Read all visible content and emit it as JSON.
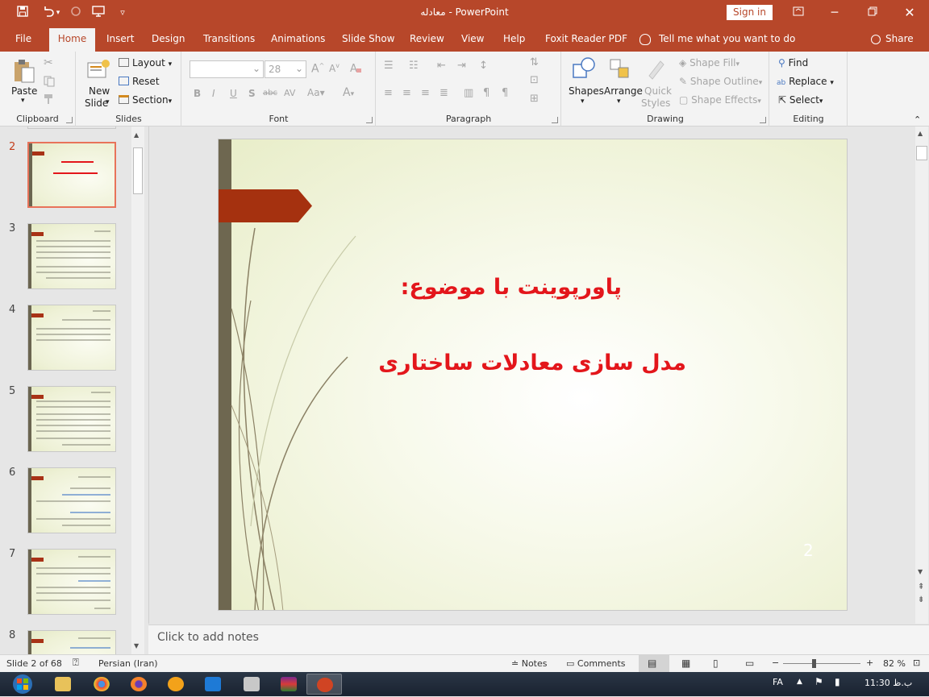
{
  "titlebar": {
    "title": "معادله  -  PowerPoint",
    "sign_in": "Sign in"
  },
  "tabs": [
    "File",
    "Home",
    "Insert",
    "Design",
    "Transitions",
    "Animations",
    "Slide Show",
    "Review",
    "View",
    "Help",
    "Foxit Reader PDF"
  ],
  "tell_me": "Tell me what you want to do",
  "share": "Share",
  "ribbon": {
    "clipboard": {
      "label": "Clipboard",
      "paste": "Paste"
    },
    "slides": {
      "label": "Slides",
      "new_slide_1": "New",
      "new_slide_2": "Slide",
      "layout": "Layout",
      "reset": "Reset",
      "section": "Section"
    },
    "font": {
      "label": "Font",
      "font_size": "28"
    },
    "paragraph": {
      "label": "Paragraph"
    },
    "drawing": {
      "label": "Drawing",
      "shapes": "Shapes",
      "arrange": "Arrange",
      "quick_1": "Quick",
      "quick_2": "Styles",
      "shape_fill": "Shape Fill",
      "shape_outline": "Shape Outline",
      "shape_effects": "Shape Effects"
    },
    "editing": {
      "label": "Editing",
      "find": "Find",
      "replace": "Replace",
      "select": "Select"
    }
  },
  "thumbnails": {
    "n2": "2",
    "n3": "3",
    "n4": "4",
    "n5": "5",
    "n6": "6",
    "n7": "7",
    "n8": "8"
  },
  "slide": {
    "title": "پاورپوینت با موضوع:",
    "subtitle": "مدل سازی معادلات ساختاری",
    "number": "2"
  },
  "notes_placeholder": "Click to add notes",
  "status": {
    "slide_info": "Slide 2 of 68",
    "language": "Persian (Iran)",
    "notes": "Notes",
    "comments": "Comments",
    "zoom": "82 %"
  },
  "taskbar": {
    "lang": "FA",
    "time": "11:30 ب.ظ"
  },
  "colors": {
    "accent": "#b7472a",
    "slide_text": "#e3161b",
    "flag": "#a5310f"
  }
}
